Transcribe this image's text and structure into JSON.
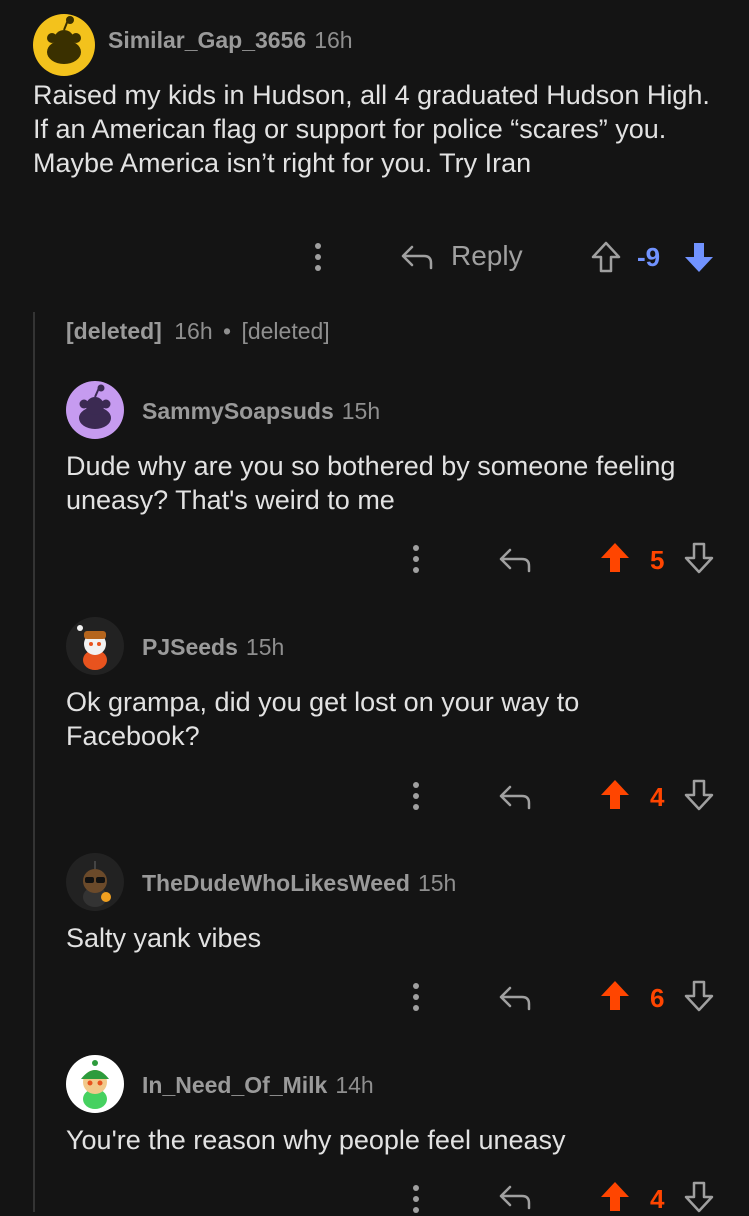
{
  "comments": {
    "root": {
      "username": "Similar_Gap_3656",
      "time": "16h",
      "text": "Raised my kids in Hudson, all 4 graduated Hudson High. If an American flag or support for police “scares” you. Maybe America isn’t right for you. Try Iran",
      "reply_label": "Reply",
      "score": "-9",
      "vote_state": "downvoted"
    },
    "deleted": {
      "username": "[deleted]",
      "time": "16h",
      "separator": "•",
      "text": "[deleted]"
    },
    "replies": [
      {
        "username": "SammySoapsuds",
        "time": "15h",
        "text": "Dude why are you so bothered by someone feeling uneasy? That's weird to me",
        "score": "5",
        "vote_state": "upvoted"
      },
      {
        "username": "PJSeeds",
        "time": "15h",
        "text": "Ok grampa, did you get lost on your way to Facebook?",
        "score": "4",
        "vote_state": "upvoted"
      },
      {
        "username": "TheDudeWhoLikesWeed",
        "time": "15h",
        "text": "Salty yank vibes",
        "score": "6",
        "vote_state": "upvoted"
      },
      {
        "username": "In_Need_Of_Milk",
        "time": "14h",
        "text": "You're the reason why people feel uneasy",
        "score": "4",
        "vote_state": "upvoted"
      }
    ]
  },
  "colors": {
    "background": "#141414",
    "upvote": "#ff4500",
    "downvote": "#7193ff",
    "muted": "#9a9a9a",
    "text": "#e2e2e2"
  }
}
